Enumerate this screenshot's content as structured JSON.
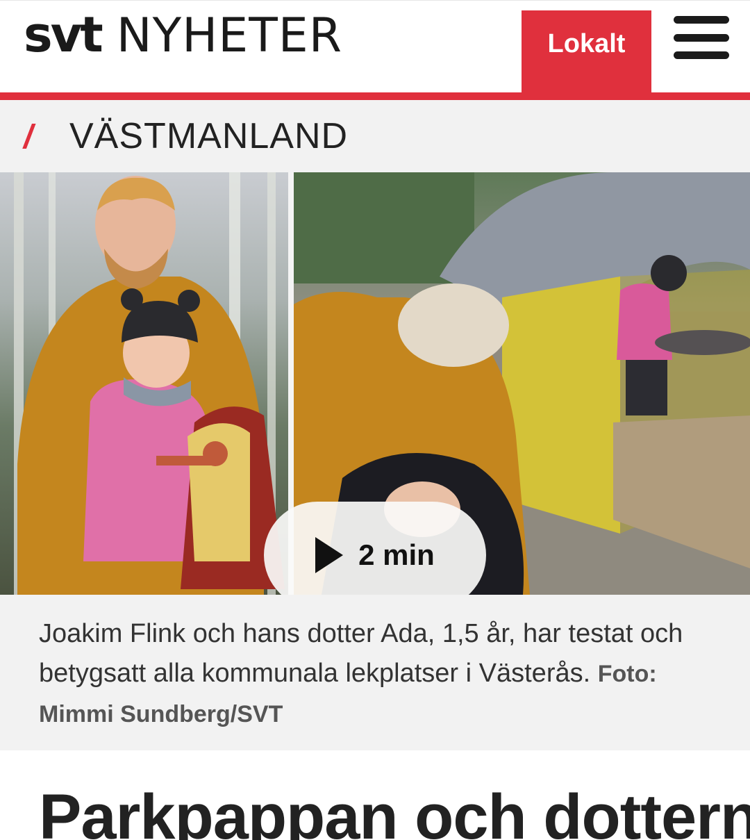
{
  "header": {
    "logo_svt": "svt",
    "logo_nyheter": "NYHETER",
    "lokalt_label": "Lokalt",
    "menu_icon": "hamburger-menu-icon"
  },
  "section": {
    "name": "VÄSTMANLAND"
  },
  "media": {
    "video_duration": "2 min",
    "play_icon": "play-icon"
  },
  "caption": {
    "text": "Joakim Flink och hans dotter Ada, 1,5 år, har testat och betygsatt alla kommunala lekplatser i Västerås.",
    "credit": "Foto: Mimmi Sundberg/SVT"
  },
  "article": {
    "headline": "Parkpappan och dottern"
  },
  "colors": {
    "accent": "#e0303d",
    "section_bg": "#f2f2f2"
  }
}
